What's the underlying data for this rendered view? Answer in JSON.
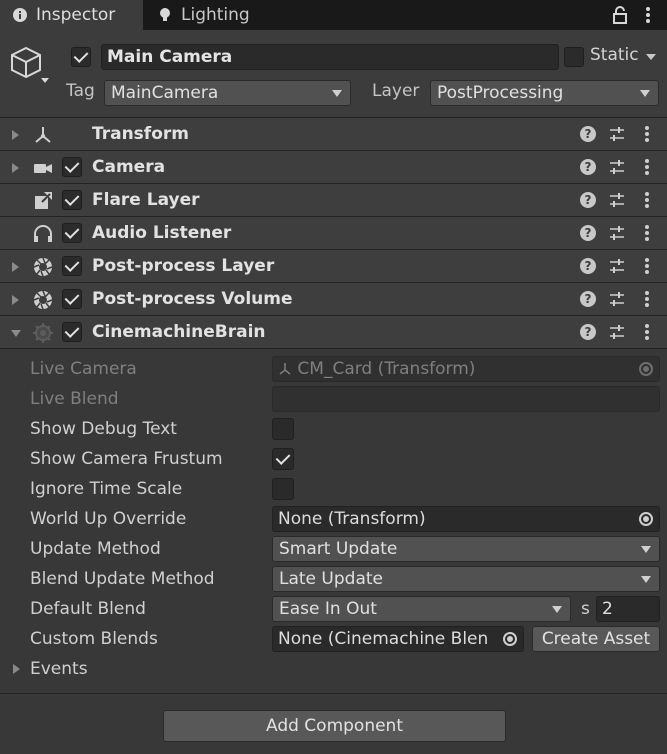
{
  "tabs": [
    {
      "label": "Inspector",
      "icon": "info-icon"
    },
    {
      "label": "Lighting",
      "icon": "bulb-icon"
    }
  ],
  "header": {
    "object_name": "Main Camera",
    "active": true,
    "static_label": "Static",
    "tag_label": "Tag",
    "tag_value": "MainCamera",
    "layer_label": "Layer",
    "layer_value": "PostProcessing"
  },
  "components": [
    {
      "title": "Transform",
      "icon": "transform-icon",
      "has_checkbox": false
    },
    {
      "title": "Camera",
      "icon": "camera-icon",
      "has_checkbox": true
    },
    {
      "title": "Flare Layer",
      "icon": "flare-icon",
      "has_checkbox": true
    },
    {
      "title": "Audio Listener",
      "icon": "headphones-icon",
      "has_checkbox": true
    },
    {
      "title": "Post-process Layer",
      "icon": "aperture-icon",
      "has_checkbox": true
    },
    {
      "title": "Post-process Volume",
      "icon": "aperture-icon",
      "has_checkbox": true
    },
    {
      "title": "CinemachineBrain",
      "icon": "cinemachine-icon",
      "has_checkbox": true,
      "expanded": true
    }
  ],
  "brain": {
    "live_camera_label": "Live Camera",
    "live_camera_value": "CM_Card (Transform)",
    "live_blend_label": "Live Blend",
    "live_blend_value": "",
    "show_debug_text_label": "Show Debug Text",
    "show_debug_text": false,
    "show_camera_frustum_label": "Show Camera Frustum",
    "show_camera_frustum": true,
    "ignore_time_scale_label": "Ignore Time Scale",
    "ignore_time_scale": false,
    "world_up_override_label": "World Up Override",
    "world_up_override_value": "None (Transform)",
    "update_method_label": "Update Method",
    "update_method_value": "Smart Update",
    "blend_update_method_label": "Blend Update Method",
    "blend_update_method_value": "Late Update",
    "default_blend_label": "Default Blend",
    "default_blend_value": "Ease In Out",
    "default_blend_unit": "s",
    "default_blend_time": "2",
    "custom_blends_label": "Custom Blends",
    "custom_blends_value": "None (Cinemachine Blen",
    "create_asset_label": "Create Asset",
    "events_label": "Events"
  },
  "footer": {
    "add_component_label": "Add Component"
  }
}
